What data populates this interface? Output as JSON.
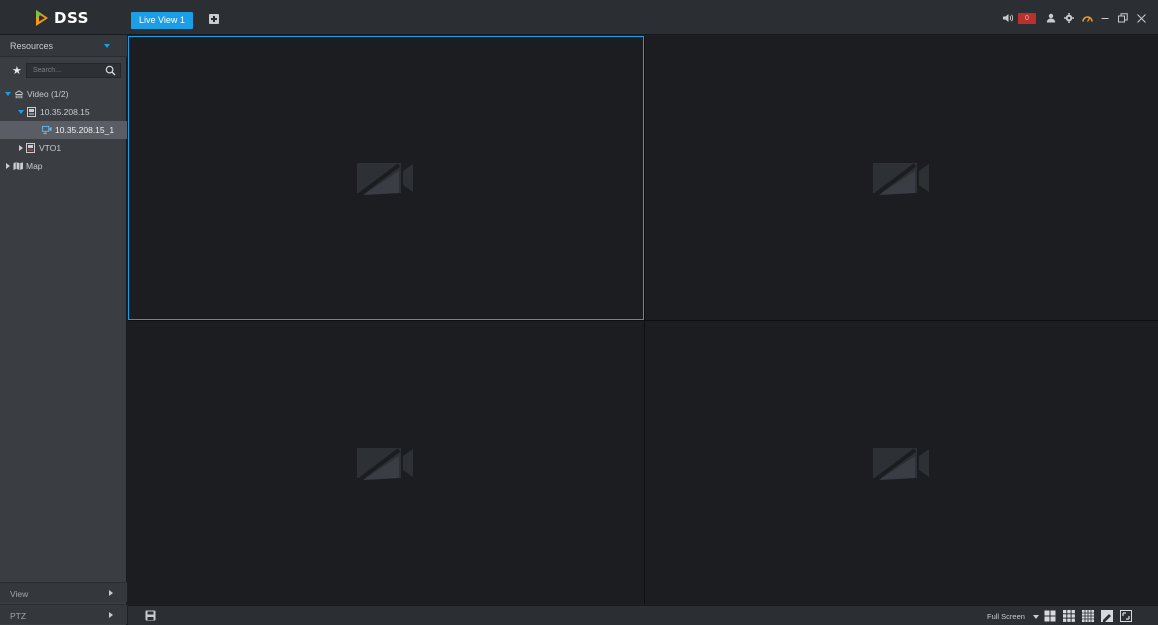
{
  "app": {
    "brand": "DSS"
  },
  "tabs": [
    {
      "label": "Live View 1",
      "active": true
    }
  ],
  "header": {
    "alarm_count": "0"
  },
  "sidebar": {
    "section_label": "Resources",
    "search_placeholder": "Search...",
    "tree": [
      {
        "label": "Video (1/2)",
        "level": 0,
        "expanded": true,
        "icon": "video-group-icon"
      },
      {
        "label": "10.35.208.15",
        "level": 1,
        "expanded": true,
        "icon": "device-icon"
      },
      {
        "label": "10.35.208.15_1",
        "level": 2,
        "selected": true,
        "icon": "camera-channel-icon"
      },
      {
        "label": "VTO1",
        "level": 1,
        "expanded": false,
        "icon": "device-icon"
      },
      {
        "label": "Map",
        "level": 0,
        "expanded": false,
        "icon": "map-icon"
      }
    ],
    "bottom_sections": [
      {
        "label": "View"
      },
      {
        "label": "PTZ"
      }
    ]
  },
  "grid": {
    "layout": "2x2",
    "active_pane": 1
  },
  "bottombar": {
    "fullscreen_label": "Full Screen"
  },
  "colors": {
    "accent": "#1a9ee6",
    "alarm": "#b9312c"
  }
}
